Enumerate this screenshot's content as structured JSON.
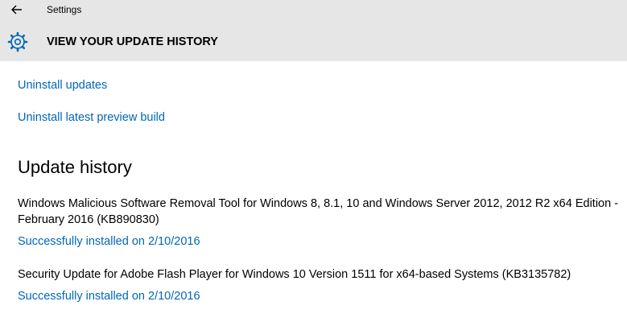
{
  "window": {
    "app_title": "Settings",
    "page_title": "VIEW YOUR UPDATE HISTORY"
  },
  "links": {
    "uninstall_updates": "Uninstall updates",
    "uninstall_preview": "Uninstall latest preview build"
  },
  "history": {
    "title": "Update history",
    "items": [
      {
        "name": "Windows Malicious Software Removal Tool for Windows 8, 8.1, 10 and Windows Server 2012, 2012 R2 x64 Edition - February 2016 (KB890830)",
        "status": "Successfully installed on 2/10/2016"
      },
      {
        "name": "Security Update for Adobe Flash Player for Windows 10 Version 1511 for x64-based Systems (KB3135782)",
        "status": "Successfully installed on 2/10/2016"
      }
    ]
  },
  "icons": {
    "back": "back-arrow-icon",
    "settings": "gear-icon"
  },
  "colors": {
    "accent": "#0067b8",
    "header_bg": "#e6e6e6",
    "text": "#000000"
  }
}
